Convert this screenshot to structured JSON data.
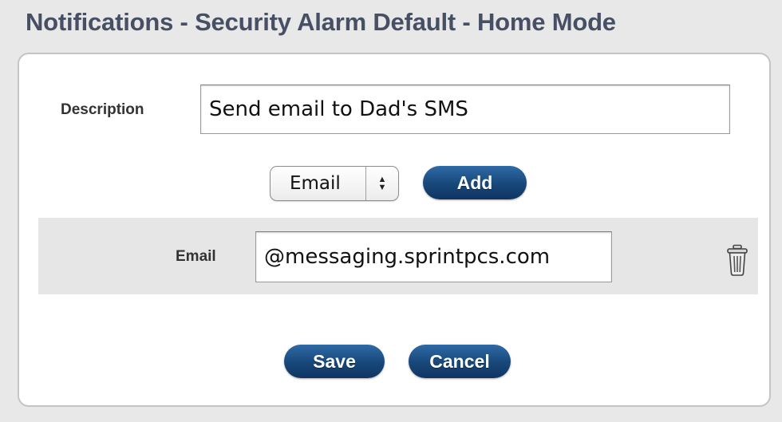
{
  "header": {
    "title": "Notifications - Security Alarm Default - Home Mode"
  },
  "form": {
    "description_label": "Description",
    "description_value": "Send email to Dad's SMS",
    "type_select": {
      "selected": "Email"
    },
    "add_label": "Add",
    "email_row": {
      "label": "Email",
      "value": "@messaging.sprintpcs.com",
      "delete_icon": "trash-icon"
    },
    "save_label": "Save",
    "cancel_label": "Cancel"
  },
  "colors": {
    "title": "#464f63",
    "button": "#184779",
    "row_background": "#e6e6e6"
  }
}
